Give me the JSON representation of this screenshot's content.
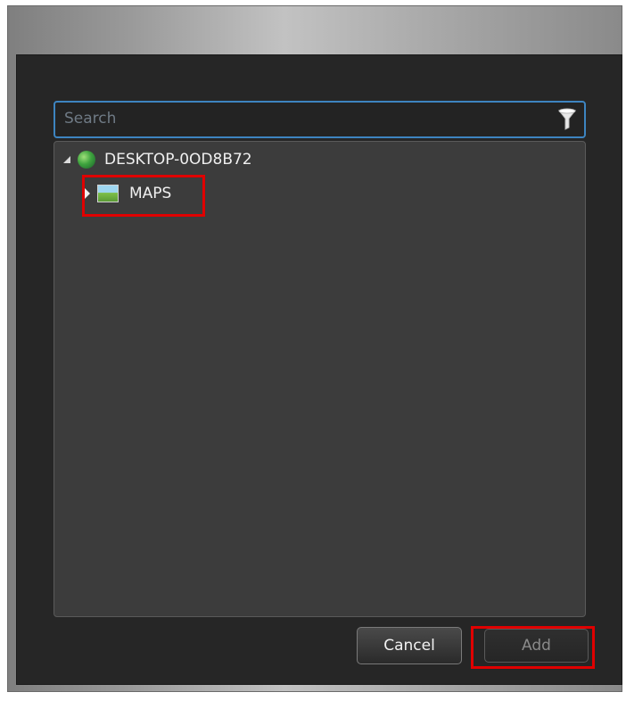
{
  "search": {
    "placeholder": "Search"
  },
  "tree": {
    "root": {
      "label": "DESKTOP-0OD8B72"
    },
    "child": {
      "label": "MAPS"
    }
  },
  "buttons": {
    "cancel": "Cancel",
    "add": "Add"
  },
  "colors": {
    "highlight": "#e00000",
    "focus": "#3d84c0"
  }
}
